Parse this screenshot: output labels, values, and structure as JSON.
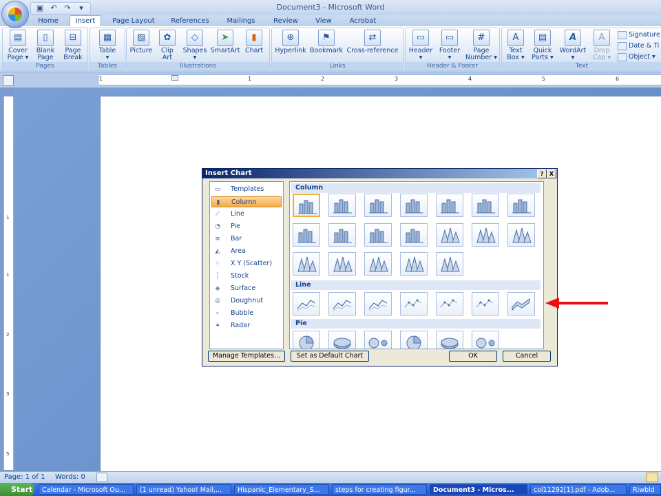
{
  "window": {
    "title": "Document3 - Microsoft Word"
  },
  "qat": {
    "icons": [
      "save-icon",
      "undo-icon",
      "redo-icon",
      "customize-icon"
    ]
  },
  "tabs": [
    "Home",
    "Insert",
    "Page Layout",
    "References",
    "Mailings",
    "Review",
    "View",
    "Acrobat"
  ],
  "active_tab": "Insert",
  "ribbon": {
    "groups": {
      "pages": "Pages",
      "tables": "Tables",
      "illustrations": "Illustrations",
      "links": "Links",
      "header_footer": "Header & Footer",
      "text": "Text"
    },
    "buttons": {
      "cover_page": [
        "Cover",
        "Page ▾"
      ],
      "blank_page": [
        "Blank",
        "Page"
      ],
      "page_break": [
        "Page",
        "Break"
      ],
      "table": [
        "Table",
        "▾"
      ],
      "picture": [
        "Picture",
        ""
      ],
      "clip_art": [
        "Clip",
        "Art"
      ],
      "shapes": [
        "Shapes",
        "▾"
      ],
      "smartart": [
        "SmartArt",
        ""
      ],
      "chart": [
        "Chart",
        ""
      ],
      "hyperlink": [
        "Hyperlink",
        ""
      ],
      "bookmark": [
        "Bookmark",
        ""
      ],
      "cross_reference": [
        "Cross-reference",
        ""
      ],
      "header": [
        "Header",
        "▾"
      ],
      "footer": [
        "Footer",
        "▾"
      ],
      "page_number": [
        "Page",
        "Number ▾"
      ],
      "text_box": [
        "Text",
        "Box ▾"
      ],
      "quick_parts": [
        "Quick",
        "Parts ▾"
      ],
      "wordart": [
        "WordArt",
        "▾"
      ],
      "drop_cap": [
        "Drop",
        "Cap ▾"
      ],
      "signature": "Signature",
      "date_time": "Date & Ti",
      "object": "Object ▾"
    }
  },
  "ruler": {
    "h_numbers": [
      "1",
      "1",
      "2",
      "3",
      "4",
      "5",
      "6"
    ],
    "v_numbers": [
      "1",
      "1",
      "2",
      "3",
      "4",
      "5"
    ]
  },
  "dialog": {
    "title": "Insert Chart",
    "title_buttons": [
      "?",
      "X"
    ],
    "categories": [
      {
        "label": "Templates",
        "icon": "folder-icon"
      },
      {
        "label": "Column",
        "icon": "column-chart-icon"
      },
      {
        "label": "Line",
        "icon": "line-chart-icon"
      },
      {
        "label": "Pie",
        "icon": "pie-chart-icon"
      },
      {
        "label": "Bar",
        "icon": "bar-chart-icon"
      },
      {
        "label": "Area",
        "icon": "area-chart-icon"
      },
      {
        "label": "X Y (Scatter)",
        "icon": "scatter-chart-icon"
      },
      {
        "label": "Stock",
        "icon": "stock-chart-icon"
      },
      {
        "label": "Surface",
        "icon": "surface-chart-icon"
      },
      {
        "label": "Doughnut",
        "icon": "doughnut-chart-icon"
      },
      {
        "label": "Bubble",
        "icon": "bubble-chart-icon"
      },
      {
        "label": "Radar",
        "icon": "radar-chart-icon"
      }
    ],
    "selected_category": "Column",
    "sections": [
      "Column",
      "Line",
      "Pie"
    ],
    "buttons": {
      "manage_templates": "Manage Templates...",
      "set_default": "Set as Default Chart",
      "ok": "OK",
      "cancel": "Cancel"
    }
  },
  "status": {
    "page": "Page: 1 of 1",
    "words": "Words: 0"
  },
  "taskbar": {
    "start": "Start",
    "tasks": [
      "Calendar - Microsoft Ou...",
      "(1 unread) Yahoo! Mail,...",
      "Hispanic_Elementary_S...",
      "steps for creating figur...",
      "Document3 - Micros...",
      "col11292[1].pdf - Adob...",
      "Riwbld"
    ],
    "active_task": "Document3 - Micros..."
  },
  "annotation": {
    "arrow_color": "#e81010"
  }
}
